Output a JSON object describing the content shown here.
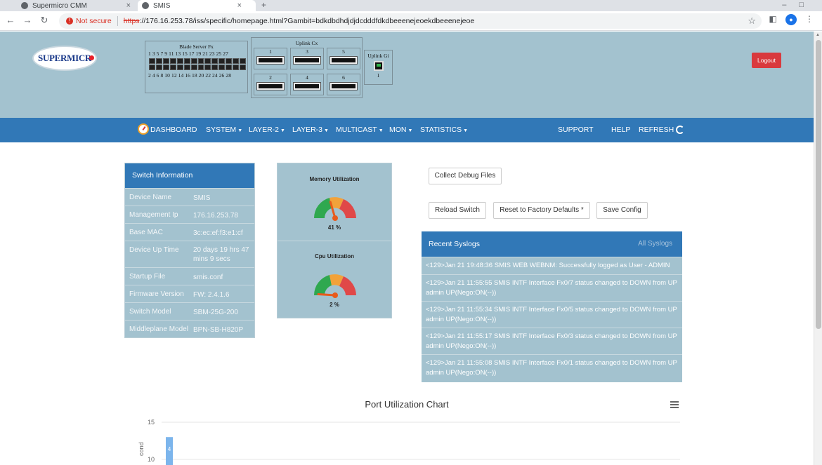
{
  "browser": {
    "tabs": [
      {
        "title": "Supermicro CMM"
      },
      {
        "title": "SMIS"
      }
    ],
    "new_tab": "+",
    "not_secure": "Not secure",
    "url_scheme": "https",
    "url_rest": "://176.16.253.78/iss/specific/homepage.html?Gambit=bdkdbdhdjdjdcdddfdkdbeeenejeoekdbeeenejeoe"
  },
  "header": {
    "logo_text": "SUPERMICR",
    "blade_title": "Blade Server Fx",
    "blade_odd": "1 3 5 7 9 11 13 15 17 19 21 23 25 27",
    "blade_even": "2 4 6 8 10 12 14 16 18 20 22 24 26 28",
    "uplink_cx_title": "Uplink Cx",
    "uplink_cx_ports": [
      "1",
      "3",
      "5",
      "2",
      "4",
      "6"
    ],
    "uplink_gi_title": "Uplink Gi",
    "uplink_gi_port": "1",
    "logout": "Logout"
  },
  "nav": {
    "dashboard": "DASHBOARD",
    "system": "SYSTEM",
    "layer2": "LAYER-2",
    "layer3": "LAYER-3",
    "multicast": "MULTICAST",
    "mon": "MON",
    "statistics": "STATISTICS",
    "support": "SUPPORT",
    "help": "HELP",
    "refresh": "REFRESH"
  },
  "switch_info": {
    "title": "Switch Information",
    "rows": [
      {
        "k": "Device Name",
        "v": "SMIS"
      },
      {
        "k": "Management Ip",
        "v": "176.16.253.78"
      },
      {
        "k": "Base MAC",
        "v": "3c:ec:ef:f3:e1:cf"
      },
      {
        "k": "Device Up Time",
        "v": "20 days 19 hrs 47 mins 9 secs"
      },
      {
        "k": "Startup File",
        "v": "smis.conf"
      },
      {
        "k": "Firmware Version",
        "v": "FW: 2.4.1.6"
      },
      {
        "k": "Switch Model",
        "v": "SBM-25G-200"
      },
      {
        "k": "Middleplane Model",
        "v": "BPN-SB-H820P"
      }
    ]
  },
  "gauges": {
    "memory": {
      "title": "Memory Utilization",
      "label": "41 %",
      "value": 41
    },
    "cpu": {
      "title": "Cpu Utilization",
      "label": "2 %",
      "value": 2
    }
  },
  "actions": {
    "collect_debug": "Collect Debug Files",
    "reload": "Reload Switch",
    "factory_reset": "Reset to Factory Defaults *",
    "save_config": "Save Config"
  },
  "syslogs": {
    "title": "Recent Syslogs",
    "all_link": "All Syslogs",
    "entries": [
      "<129>Jan 21 19:48:36 SMIS WEB WEBNM: Successfully logged as User - ADMIN",
      "<129>Jan 21 11:55:55 SMIS INTF Interface Fx0/7 status changed to DOWN from UP admin UP(Nego:ON(--))",
      "<129>Jan 21 11:55:34 SMIS INTF Interface Fx0/5 status changed to DOWN from UP admin UP(Nego:ON(--))",
      "<129>Jan 21 11:55:17 SMIS INTF Interface Fx0/3 status changed to DOWN from UP admin UP(Nego:ON(--))",
      "<129>Jan 21 11:55:08 SMIS INTF Interface Fx0/1 status changed to DOWN from UP admin UP(Nego:ON(--))"
    ]
  },
  "chart_data": {
    "type": "bar",
    "title": "Port Utilization Chart",
    "ylabel": "cond",
    "ylim": [
      0,
      15
    ],
    "yticks": [
      10,
      15
    ],
    "values": [
      13
    ],
    "data_labels": [
      "4"
    ],
    "grid": true
  }
}
